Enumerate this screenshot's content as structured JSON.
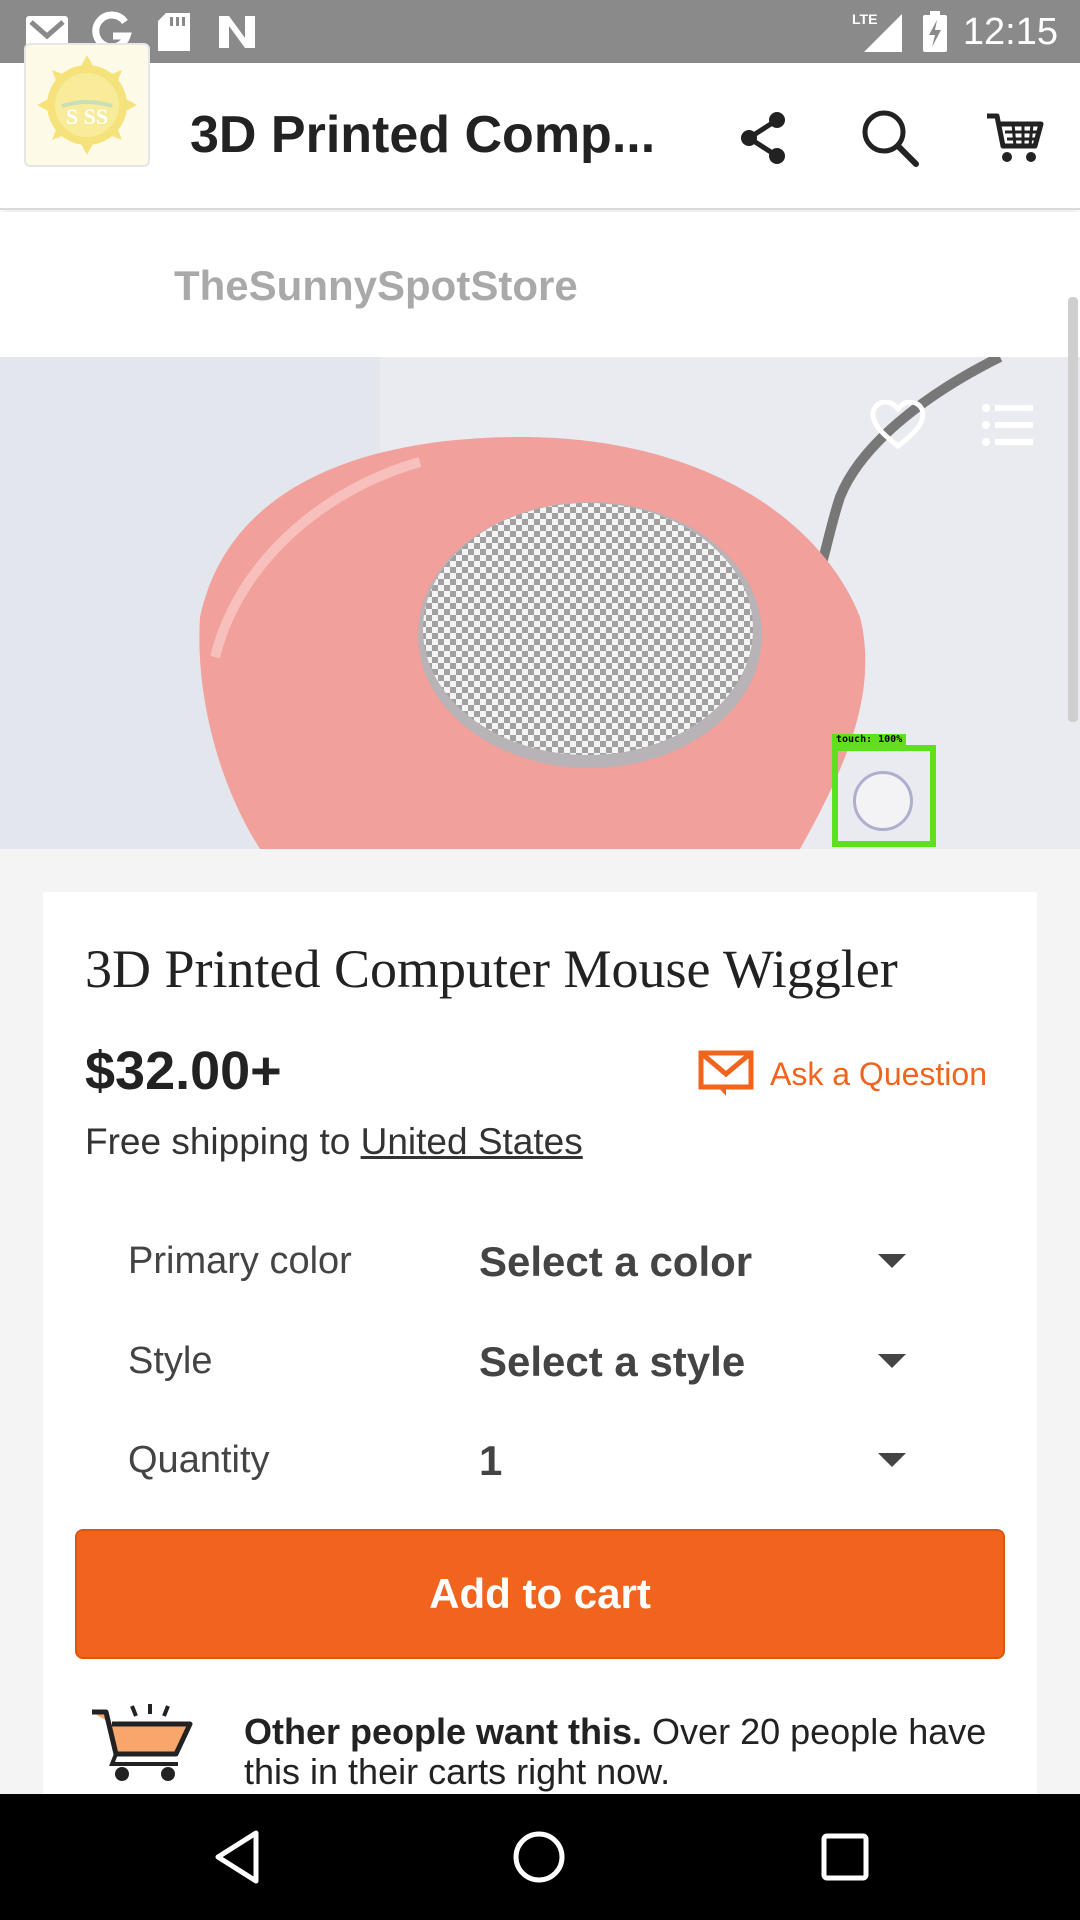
{
  "status_bar": {
    "time": "12:15",
    "network": "LTE",
    "icons": [
      "gmail-icon",
      "google-icon",
      "sd-card-icon",
      "n-icon",
      "signal-icon",
      "battery-icon"
    ]
  },
  "app_bar": {
    "title": "3D Printed Comp...",
    "icons": [
      "menu-icon",
      "share-icon",
      "search-icon",
      "cart-icon"
    ],
    "accent_color": "#f1641e"
  },
  "shop": {
    "name": "TheSunnySpotStore",
    "logo_text": "S SS"
  },
  "hero": {
    "icons": [
      "favorite-heart-icon",
      "list-icon"
    ],
    "touch_overlay_label": "touch: 100%"
  },
  "product": {
    "title": "3D Printed Computer Mouse Wiggler",
    "price": "$32.00+",
    "ask_label": "Ask a Question",
    "shipping_prefix": "Free shipping to ",
    "shipping_destination": "United States"
  },
  "options": [
    {
      "label": "Primary color",
      "value": "Select a color"
    },
    {
      "label": "Style",
      "value": "Select a style"
    },
    {
      "label": "Quantity",
      "value": "1"
    }
  ],
  "add_to_cart": {
    "label": "Add to cart",
    "color": "#f1641e"
  },
  "promo": {
    "bold": "Other people want this.",
    "rest": " Over 20 people have this in their carts right now."
  },
  "nav_bar": {
    "icons": [
      "back-icon",
      "home-icon",
      "recents-icon"
    ]
  }
}
